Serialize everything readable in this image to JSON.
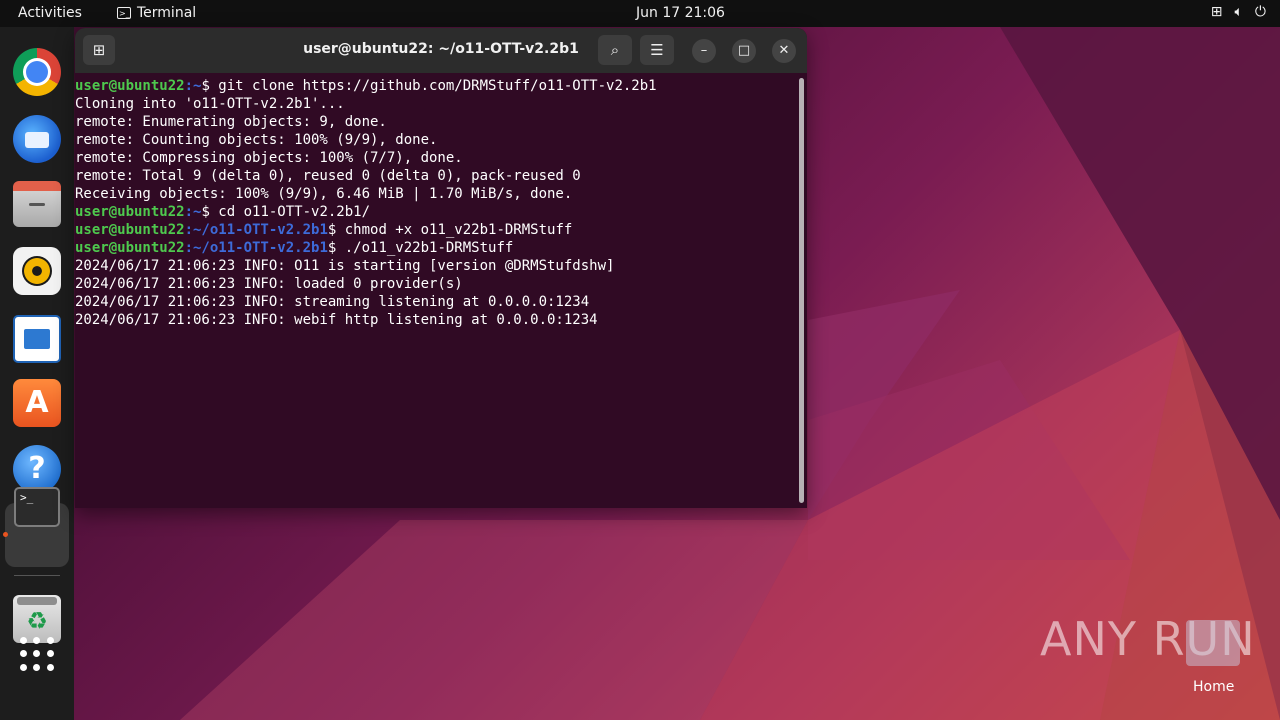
{
  "topbar": {
    "activities": "Activities",
    "app_name": "Terminal",
    "clock": "Jun 17  21:06",
    "tray_icons": [
      "network-icon",
      "volume-icon",
      "power-icon"
    ]
  },
  "dock": {
    "items": [
      "chrome-icon",
      "thunderbird-icon",
      "files-icon",
      "rhythmbox-icon",
      "writer-icon",
      "app-center-icon",
      "help-icon",
      "terminal-icon",
      "trash-icon",
      "show-apps-icon"
    ],
    "help_glyph": "?",
    "appcenter_glyph": "A",
    "terminal_glyph": ">_",
    "trash_glyph": "♻"
  },
  "window": {
    "title": "user@ubuntu22: ~/o11-OTT-v2.2b1",
    "lines": [
      {
        "user": "user@ubuntu22",
        "path": ":~",
        "cmd": "$ git clone https://github.com/DRMStuff/o11-OTT-v2.2b1"
      },
      {
        "text": "Cloning into 'o11-OTT-v2.2b1'..."
      },
      {
        "text": "remote: Enumerating objects: 9, done."
      },
      {
        "text": "remote: Counting objects: 100% (9/9), done."
      },
      {
        "text": "remote: Compressing objects: 100% (7/7), done."
      },
      {
        "text": "remote: Total 9 (delta 0), reused 0 (delta 0), pack-reused 0"
      },
      {
        "text": "Receiving objects: 100% (9/9), 6.46 MiB | 1.70 MiB/s, done."
      },
      {
        "user": "user@ubuntu22",
        "path": ":~",
        "cmd": "$ cd o11-OTT-v2.2b1/"
      },
      {
        "user": "user@ubuntu22",
        "path": ":~/o11-OTT-v2.2b1",
        "cmd": "$ chmod +x o11_v22b1-DRMStuff"
      },
      {
        "user": "user@ubuntu22",
        "path": ":~/o11-OTT-v2.2b1",
        "cmd": "$ ./o11_v22b1-DRMStuff"
      },
      {
        "text": "2024/06/17 21:06:23 INFO: O11 is starting [version @DRMStufdshw]"
      },
      {
        "text": "2024/06/17 21:06:23 INFO: loaded 0 provider(s)"
      },
      {
        "text": "2024/06/17 21:06:23 INFO: streaming listening at 0.0.0.0:1234"
      },
      {
        "text": "2024/06/17 21:06:23 INFO: webif http listening at 0.0.0.0:1234"
      }
    ]
  },
  "desktop": {
    "home_label": "Home",
    "watermark": "ANY RUN"
  }
}
